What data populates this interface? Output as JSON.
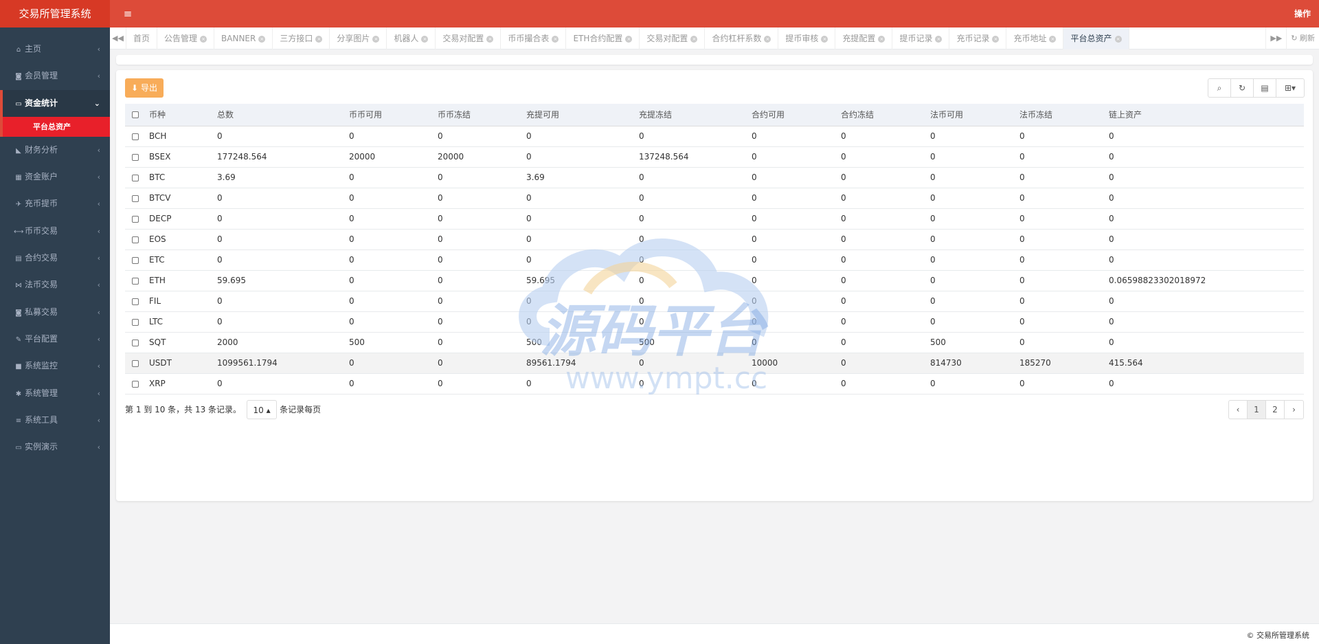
{
  "header": {
    "brand": "交易所管理系统",
    "menu_icon": "hamburger-icon",
    "operate": "操作"
  },
  "sidebar": {
    "items": [
      {
        "label": "主页",
        "icon": "home-icon",
        "glyph": "⌂"
      },
      {
        "label": "会员管理",
        "icon": "member-icon",
        "glyph": "◙"
      },
      {
        "label": "资金统计",
        "icon": "battery-icon",
        "glyph": "▭",
        "open": true
      },
      {
        "label": "财务分析",
        "icon": "area-chart-icon",
        "glyph": "◣"
      },
      {
        "label": "资金账户",
        "icon": "calculator-icon",
        "glyph": "▦"
      },
      {
        "label": "充币提币",
        "icon": "plane-icon",
        "glyph": "✈"
      },
      {
        "label": "币币交易",
        "icon": "exchange-icon",
        "glyph": "⟷"
      },
      {
        "label": "合约交易",
        "icon": "contract-icon",
        "glyph": "▤"
      },
      {
        "label": "法币交易",
        "icon": "handshake-icon",
        "glyph": "⋈"
      },
      {
        "label": "私募交易",
        "icon": "wallet-icon",
        "glyph": "◙"
      },
      {
        "label": "平台配置",
        "icon": "wrench-icon",
        "glyph": "✎"
      },
      {
        "label": "系统监控",
        "icon": "camera-icon",
        "glyph": "■"
      },
      {
        "label": "系统管理",
        "icon": "gear-icon",
        "glyph": "✱"
      },
      {
        "label": "系统工具",
        "icon": "list-icon",
        "glyph": "≡"
      },
      {
        "label": "实例演示",
        "icon": "desktop-icon",
        "glyph": "▭"
      }
    ],
    "sub_active": "平台总资产"
  },
  "tabs": {
    "items": [
      "首页",
      "公告管理",
      "BANNER",
      "三方接口",
      "分享图片",
      "机器人",
      "交易对配置",
      "币币撮合表",
      "ETH合约配置",
      "交易对配置",
      "合约杠杆系数",
      "提币审核",
      "充提配置",
      "提币记录",
      "充币记录",
      "充币地址",
      "平台总资产"
    ],
    "refresh": "刷新"
  },
  "toolbar": {
    "export_label": "导出",
    "tools": [
      "search-icon",
      "refresh-icon",
      "columns-icon",
      "grid-icon"
    ]
  },
  "table": {
    "columns": [
      "币种",
      "总数",
      "币币可用",
      "币币冻结",
      "充提可用",
      "充提冻结",
      "合约可用",
      "合约冻结",
      "法币可用",
      "法币冻结",
      "链上资产"
    ],
    "rows": [
      [
        "BCH",
        "0",
        "0",
        "0",
        "0",
        "0",
        "0",
        "0",
        "0",
        "0",
        "0"
      ],
      [
        "BSEX",
        "177248.564",
        "20000",
        "20000",
        "0",
        "137248.564",
        "0",
        "0",
        "0",
        "0",
        "0"
      ],
      [
        "BTC",
        "3.69",
        "0",
        "0",
        "3.69",
        "0",
        "0",
        "0",
        "0",
        "0",
        "0"
      ],
      [
        "BTCV",
        "0",
        "0",
        "0",
        "0",
        "0",
        "0",
        "0",
        "0",
        "0",
        "0"
      ],
      [
        "DECP",
        "0",
        "0",
        "0",
        "0",
        "0",
        "0",
        "0",
        "0",
        "0",
        "0"
      ],
      [
        "EOS",
        "0",
        "0",
        "0",
        "0",
        "0",
        "0",
        "0",
        "0",
        "0",
        "0"
      ],
      [
        "ETC",
        "0",
        "0",
        "0",
        "0",
        "0",
        "0",
        "0",
        "0",
        "0",
        "0"
      ],
      [
        "ETH",
        "59.695",
        "0",
        "0",
        "59.695",
        "0",
        "0",
        "0",
        "0",
        "0",
        "0.06598823302018972"
      ],
      [
        "FIL",
        "0",
        "0",
        "0",
        "0",
        "0",
        "0",
        "0",
        "0",
        "0",
        "0"
      ],
      [
        "LTC",
        "0",
        "0",
        "0",
        "0",
        "0",
        "0",
        "0",
        "0",
        "0",
        "0"
      ],
      [
        "SQT",
        "2000",
        "500",
        "0",
        "500",
        "500",
        "0",
        "0",
        "500",
        "0",
        "0"
      ],
      [
        "USDT",
        "1099561.1794",
        "0",
        "0",
        "89561.1794",
        "0",
        "10000",
        "0",
        "814730",
        "185270",
        "415.564"
      ],
      [
        "XRP",
        "0",
        "0",
        "0",
        "0",
        "0",
        "0",
        "0",
        "0",
        "0",
        "0"
      ]
    ]
  },
  "pager": {
    "info": "第 1 到 10 条，共 13 条记录。",
    "size": "10",
    "suffix": "条记录每页",
    "pages": [
      "‹",
      "1",
      "2",
      "›"
    ],
    "current": "1"
  },
  "footer": "© 交易所管理系统",
  "watermark": {
    "cn": "源码平台",
    "url": "www.ympt.cc"
  }
}
